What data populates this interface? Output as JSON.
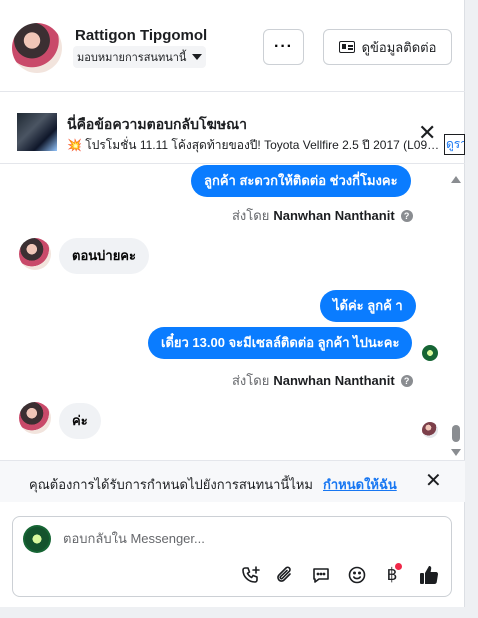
{
  "contact": {
    "name": "Rattigon Tipgomol",
    "assign_label": "มอบหมายการสนทนานี้",
    "contact_info_label": "ดูข้อมูลติดต่อ"
  },
  "ad_reply": {
    "title": "นี่คือข้อความตอบกลับโฆษณา",
    "description": "💥 โปรโมชั่น 11.11 โค้งสุดท้ายของปี! Toyota Vellfire 2.5 ปี 2017 (L090) ...",
    "link_label": "ดูรา"
  },
  "messages": {
    "m1": "ลูกค้า สะดวกให้ติดต่อ ช่วงกี่โมงคะ",
    "sent_by_prefix": "ส่งโดย",
    "sender": "Nanwhan Nanthanit",
    "m2": "ตอนบ่ายคะ",
    "m3": "ได้ค่ะ  ลูกค้ า",
    "m4": "เดี๋ยว 13.00 จะมีเซลล์ติดต่อ ลูกค้า  ไปนะคะ",
    "m5": "ค่ะ"
  },
  "assign_prompt": {
    "question": "คุณต้องการได้รับการกำหนดไปยังการสนทนานี้ไหม",
    "action": "กำหนดให้ฉัน"
  },
  "composer": {
    "placeholder": "ตอบกลับใน Messenger..."
  },
  "colors": {
    "outgoing_bubble": "#0a7cff",
    "incoming_bubble": "#f0f2f5",
    "link": "#1877f2",
    "notification_dot": "#f02849"
  }
}
